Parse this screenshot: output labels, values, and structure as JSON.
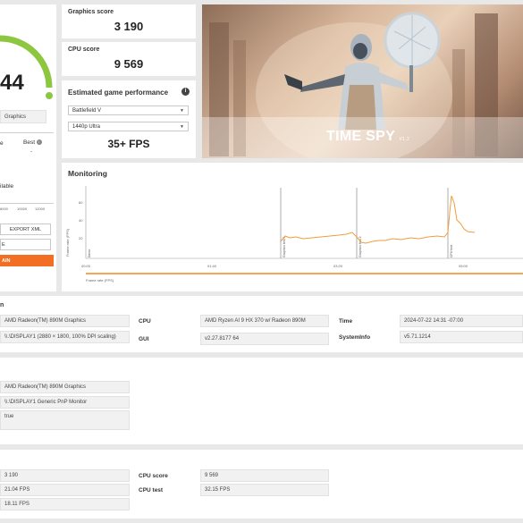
{
  "left_panel": {
    "score_partial": "44",
    "gpu_partial": "Graphics",
    "col_left": "e",
    "col_best": "Best",
    "col_best_value": "-",
    "available_partial": "ilable",
    "axis_ticks": [
      "8000",
      "10000",
      "12000"
    ],
    "export_label": "EXPORT XML",
    "e_label": "E",
    "run_partial": "AIN"
  },
  "scores": {
    "graphics_label": "Graphics score",
    "graphics_value": "3 190",
    "cpu_label": "CPU score",
    "cpu_value": "9 569"
  },
  "game_perf": {
    "title": "Estimated game performance",
    "game": "Battlefield V",
    "resolution": "1440p Ultra",
    "fps": "35+ FPS"
  },
  "banner": {
    "title": "TIME SPY",
    "version": "V1.2"
  },
  "monitoring": {
    "title": "Monitoring",
    "y_label_top": "Frame rate (FPS)",
    "y_ticks": [
      "60",
      "40",
      "20"
    ],
    "x_ticks": [
      "00:00",
      "01:40",
      "03:20",
      "05:00"
    ],
    "markers": [
      "Demo",
      "Graphics test 1",
      "Graphics test 2",
      "CPU test"
    ],
    "legend": "Frame rate (FPS)",
    "line_color": "#f39c3a"
  },
  "system_info": {
    "section_partial": "n",
    "gpu_field": "AMD Radeon(TM) 890M Graphics",
    "display_field": "\\\\.\\DISPLAY1 (2880 × 1800, 100% DPI scaling)",
    "cpu_label": "CPU",
    "cpu_value": "AMD Ryzen AI 9 HX 370 w/ Radeon 890M",
    "gui_label": "GUI",
    "gui_value": "v2.27.8177 64",
    "time_label": "Time",
    "time_value": "2024-07-22 14:31 -07:00",
    "sysinfo_label": "SystemInfo",
    "sysinfo_value": "v5.71.1214"
  },
  "settings": {
    "gpu_field": "AMD Radeon(TM) 890M Graphics",
    "display_field": "\\\\.\\DISPLAY1 Generic PnP Monitor",
    "flag_field": "true"
  },
  "results": {
    "graphics_score_value": "3 190",
    "gt1_value": "21.04 FPS",
    "gt2_value": "18.11 FPS",
    "cpu_score_label": "CPU score",
    "cpu_score_value": "9 569",
    "cpu_test_label": "CPU test",
    "cpu_test_value": "32.15 FPS"
  },
  "colors": {
    "accent": "#f26e22",
    "gauge": "#8dc63f",
    "banner_bg": "#c9a98f"
  }
}
